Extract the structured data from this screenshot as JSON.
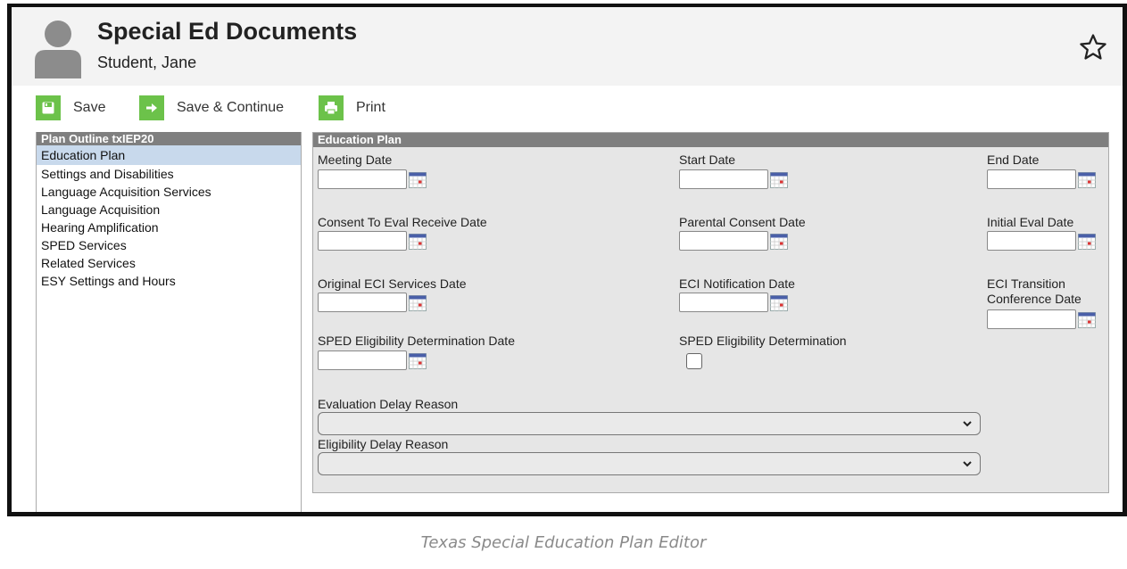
{
  "header": {
    "title": "Special Ed Documents",
    "student_name": "Student, Jane"
  },
  "toolbar": {
    "save_label": "Save",
    "save_continue_label": "Save & Continue",
    "print_label": "Print"
  },
  "sidebar": {
    "title": "Plan Outline txIEP20",
    "items": [
      {
        "label": "Education Plan"
      },
      {
        "label": "Settings and Disabilities"
      },
      {
        "label": "Language Acquisition Services"
      },
      {
        "label": "Language Acquisition"
      },
      {
        "label": "Hearing Amplification"
      },
      {
        "label": "SPED Services"
      },
      {
        "label": "Related Services"
      },
      {
        "label": "ESY Settings and Hours"
      }
    ]
  },
  "panel": {
    "title": "Education Plan",
    "fields": {
      "meeting_date": {
        "label": "Meeting Date",
        "value": ""
      },
      "start_date": {
        "label": "Start Date",
        "value": ""
      },
      "end_date": {
        "label": "End Date",
        "value": ""
      },
      "consent_eval": {
        "label": "Consent To Eval Receive Date",
        "value": ""
      },
      "parental_consent": {
        "label": "Parental Consent Date",
        "value": ""
      },
      "initial_eval": {
        "label": "Initial Eval Date",
        "value": ""
      },
      "original_eci": {
        "label": "Original ECI Services Date",
        "value": ""
      },
      "eci_notification": {
        "label": "ECI Notification Date",
        "value": ""
      },
      "eci_transition_line1": {
        "label": "ECI Transition",
        "value": ""
      },
      "eci_transition_line2": {
        "label": "Conference Date"
      },
      "sped_elig_date": {
        "label": "SPED Eligibility Determination Date",
        "value": ""
      },
      "sped_elig": {
        "label": "SPED Eligibility Determination",
        "checked": false
      },
      "eval_delay": {
        "label": "Evaluation Delay Reason",
        "selected": ""
      },
      "elig_delay": {
        "label": "Eligibility Delay Reason",
        "selected": ""
      }
    }
  },
  "caption": "Texas Special Education Plan Editor",
  "colors": {
    "accent_green": "#6cc24a",
    "section_header_gray": "#7f7f7f",
    "selected_item_blue": "#c8d9ec",
    "panel_background": "#e6e6e6"
  }
}
